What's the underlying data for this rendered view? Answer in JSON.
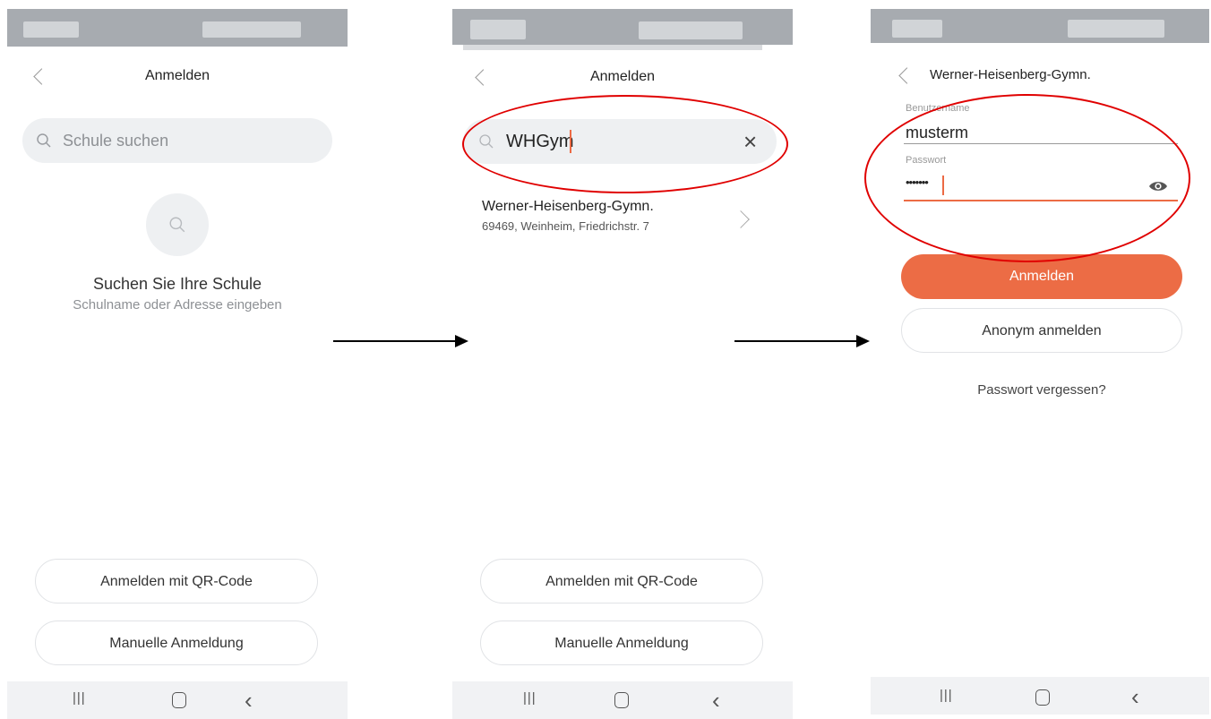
{
  "screen1": {
    "title": "Anmelden",
    "search_placeholder": "Schule suchen",
    "empty_title": "Suchen Sie Ihre Schule",
    "empty_subtitle": "Schulname oder Adresse eingeben",
    "qr_button": "Anmelden mit QR-Code",
    "manual_button": "Manuelle Anmeldung"
  },
  "screen2": {
    "title": "Anmelden",
    "search_value": "WHGym",
    "result": {
      "name": "Werner-Heisenberg-Gymn.",
      "address": "69469, Weinheim, Friedrichstr. 7"
    },
    "qr_button": "Anmelden mit QR-Code",
    "manual_button": "Manuelle Anmeldung"
  },
  "screen3": {
    "title": "Werner-Heisenberg-Gymn.",
    "username_label": "Benutzername",
    "username_value": "musterm",
    "password_label": "Passwort",
    "password_value": "•••••••",
    "login_button": "Anmelden",
    "anon_button": "Anonym anmelden",
    "forgot_link": "Passwort vergessen?"
  },
  "bottom_nav": {
    "recents": "|||",
    "home": "◯",
    "back": "‹"
  },
  "colors": {
    "accent": "#ec6c45",
    "highlight": "#e00000",
    "statusbar": "#a7abb0"
  },
  "icons": [
    "back-chevron-icon",
    "search-icon",
    "clear-icon",
    "chevron-right-icon",
    "eye-icon"
  ]
}
